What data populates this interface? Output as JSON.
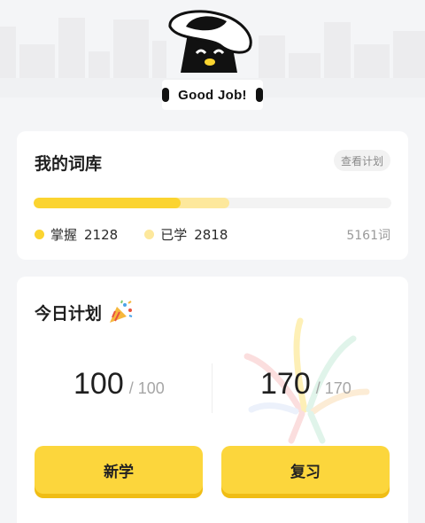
{
  "header": {
    "banner_text": "Good Job!",
    "mascot_icon": "hat-mascot-icon"
  },
  "library": {
    "title": "我的词库",
    "plan_button_label": "查看计划",
    "mastered_label": "掌握",
    "mastered_count": "2128",
    "learned_label": "已学",
    "learned_count": "2818",
    "total_label": "5161词",
    "mastered_fraction": 0.412,
    "learned_fraction": 0.546
  },
  "plan": {
    "title": "今日计划",
    "title_icon": "party-popper-icon",
    "new_done": "100",
    "new_total": "/ 100",
    "review_done": "170",
    "review_total": "/ 170",
    "new_button_label": "新学",
    "review_button_label": "复习"
  },
  "colors": {
    "accent": "#fbd430",
    "accent_light": "#fde89c",
    "background": "#f4f5f7"
  }
}
